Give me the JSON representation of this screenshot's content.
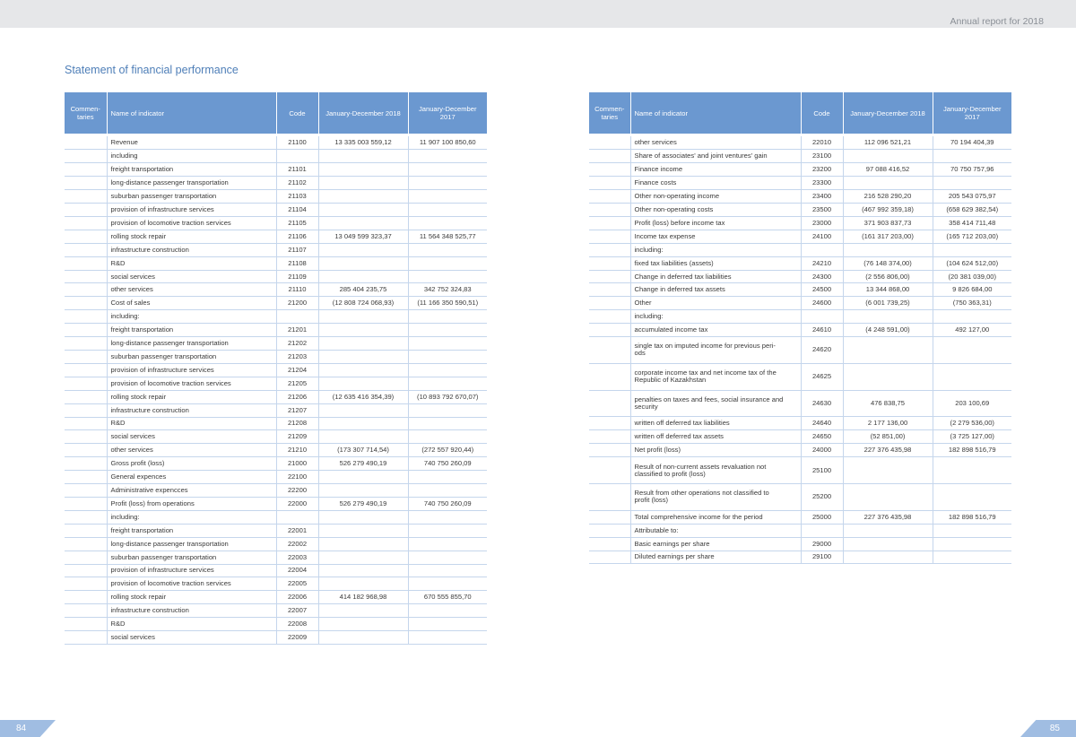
{
  "header": {
    "report_title": "Annual report for 2018"
  },
  "section_title": "Statement of financial performance",
  "table_headers": {
    "commentaries": "Commen-\ntaries",
    "name": "Name of indicator",
    "code": "Code",
    "period_2018": "January-December 2018",
    "period_2017": "January-December\n2017"
  },
  "left_rows": [
    {
      "name": "Revenue",
      "code": "21100",
      "v2018": "13 335 003 559,12",
      "v2017": "11 907 100 850,60"
    },
    {
      "name": "including",
      "code": "",
      "v2018": "",
      "v2017": ""
    },
    {
      "name": "freight transportation",
      "code": "21101",
      "v2018": "",
      "v2017": ""
    },
    {
      "name": "long-distance passenger transportation",
      "code": "21102",
      "v2018": "",
      "v2017": ""
    },
    {
      "name": "suburban passenger transportation",
      "code": "21103",
      "v2018": "",
      "v2017": ""
    },
    {
      "name": "provision of infrastructure services",
      "code": "21104",
      "v2018": "",
      "v2017": ""
    },
    {
      "name": "provision of locomotive traction services",
      "code": "21105",
      "v2018": "",
      "v2017": ""
    },
    {
      "name": "rolling stock repair",
      "code": "21106",
      "v2018": "13 049 599 323,37",
      "v2017": "11 564 348 525,77"
    },
    {
      "name": "infrastructure construction",
      "code": "21107",
      "v2018": "",
      "v2017": ""
    },
    {
      "name": "R&D",
      "code": "21108",
      "v2018": "",
      "v2017": ""
    },
    {
      "name": "social services",
      "code": "21109",
      "v2018": "",
      "v2017": ""
    },
    {
      "name": "other services",
      "code": "21110",
      "v2018": "285 404 235,75",
      "v2017": "342 752 324,83"
    },
    {
      "name": "Cost of sales",
      "code": "21200",
      "v2018": "(12 808 724 068,93)",
      "v2017": "(11 166 350 590,51)"
    },
    {
      "name": "including:",
      "code": "",
      "v2018": "",
      "v2017": ""
    },
    {
      "name": "freight transportation",
      "code": "21201",
      "v2018": "",
      "v2017": ""
    },
    {
      "name": "long-distance passenger transportation",
      "code": "21202",
      "v2018": "",
      "v2017": ""
    },
    {
      "name": "suburban passenger transportation",
      "code": "21203",
      "v2018": "",
      "v2017": ""
    },
    {
      "name": "provision of infrastructure services",
      "code": "21204",
      "v2018": "",
      "v2017": ""
    },
    {
      "name": "provision of locomotive traction services",
      "code": "21205",
      "v2018": "",
      "v2017": ""
    },
    {
      "name": "rolling stock repair",
      "code": "21206",
      "v2018": "(12 635 416 354,39)",
      "v2017": "(10 893 792 670,07)"
    },
    {
      "name": "infrastructure construction",
      "code": "21207",
      "v2018": "",
      "v2017": ""
    },
    {
      "name": "R&D",
      "code": "21208",
      "v2018": "",
      "v2017": ""
    },
    {
      "name": "social services",
      "code": "21209",
      "v2018": "",
      "v2017": ""
    },
    {
      "name": "other services",
      "code": "21210",
      "v2018": "(173 307 714,54)",
      "v2017": "(272 557 920,44)"
    },
    {
      "name": "Gross profit (loss)",
      "code": "21000",
      "v2018": "526 279 490,19",
      "v2017": "740 750 260,09"
    },
    {
      "name": "General expences",
      "code": "22100",
      "v2018": "",
      "v2017": ""
    },
    {
      "name": "Administrative expencces",
      "code": "22200",
      "v2018": "",
      "v2017": ""
    },
    {
      "name": "Profit (loss) from operations",
      "code": "22000",
      "v2018": "526 279 490,19",
      "v2017": "740 750 260,09"
    },
    {
      "name": "including:",
      "code": "",
      "v2018": "",
      "v2017": ""
    },
    {
      "name": "freight transportation",
      "code": "22001",
      "v2018": "",
      "v2017": ""
    },
    {
      "name": "long-distance passenger transportation",
      "code": "22002",
      "v2018": "",
      "v2017": ""
    },
    {
      "name": "suburban passenger transportation",
      "code": "22003",
      "v2018": "",
      "v2017": ""
    },
    {
      "name": "provision of infrastructure services",
      "code": "22004",
      "v2018": "",
      "v2017": ""
    },
    {
      "name": "provision of locomotive traction services",
      "code": "22005",
      "v2018": "",
      "v2017": ""
    },
    {
      "name": "rolling stock repair",
      "code": "22006",
      "v2018": "414 182 968,98",
      "v2017": "670 555 855,70"
    },
    {
      "name": "infrastructure construction",
      "code": "22007",
      "v2018": "",
      "v2017": ""
    },
    {
      "name": "R&D",
      "code": "22008",
      "v2018": "",
      "v2017": ""
    },
    {
      "name": "social services",
      "code": "22009",
      "v2018": "",
      "v2017": ""
    }
  ],
  "right_rows": [
    {
      "name": "other services",
      "code": "22010",
      "v2018": "112 096 521,21",
      "v2017": "70 194 404,39"
    },
    {
      "name": "Share of associates' and joint ventures' gain",
      "code": "23100",
      "v2018": "",
      "v2017": ""
    },
    {
      "name": "Finance income",
      "code": "23200",
      "v2018": "97 088 416,52",
      "v2017": "70 750 757,96"
    },
    {
      "name": "Finance costs",
      "code": "23300",
      "v2018": "",
      "v2017": ""
    },
    {
      "name": "Other non-operating income",
      "code": "23400",
      "v2018": "216 528 290,20",
      "v2017": "205 543 075,97"
    },
    {
      "name": "Other non-operating costs",
      "code": "23500",
      "v2018": "(467 992 359,18)",
      "v2017": "(658 629 382,54)"
    },
    {
      "name": "Profit (loss) before income tax",
      "code": "23000",
      "v2018": "371 903 837,73",
      "v2017": "358 414 711,48"
    },
    {
      "name": "Income tax expense",
      "code": "24100",
      "v2018": "(161 317 203,00)",
      "v2017": "(165 712 203,00)"
    },
    {
      "name": "including:",
      "code": "",
      "v2018": "",
      "v2017": ""
    },
    {
      "name": "fixed tax liabilities (assets)",
      "code": "24210",
      "v2018": "(76 148 374,00)",
      "v2017": "(104 624 512,00)"
    },
    {
      "name": "Change in deferred tax liabilities",
      "code": "24300",
      "v2018": "(2 556 806,00)",
      "v2017": "(20 381 039,00)"
    },
    {
      "name": "Change in deferred tax assets",
      "code": "24500",
      "v2018": "13 344 868,00",
      "v2017": "9 826 684,00"
    },
    {
      "name": "Other",
      "code": "24600",
      "v2018": "(6 001 739,25)",
      "v2017": "(750 363,31)"
    },
    {
      "name": "including:",
      "code": "",
      "v2018": "",
      "v2017": ""
    },
    {
      "name": "accumulated income tax",
      "code": "24610",
      "v2018": "(4 248 591,00)",
      "v2017": "492 127,00"
    },
    {
      "name": "single tax on imputed income for previous peri-\nods",
      "code": "24620",
      "v2018": "",
      "v2017": "",
      "tall": true
    },
    {
      "name": "corporate income tax and net income tax of the\nRepublic of Kazakhstan",
      "code": "24625",
      "v2018": "",
      "v2017": "",
      "tall": true
    },
    {
      "name": "penalties on taxes and fees, social insurance and\nsecurity",
      "code": "24630",
      "v2018": "476 838,75",
      "v2017": "203 100,69",
      "tall": true
    },
    {
      "name": "written off deferred tax liabilities",
      "code": "24640",
      "v2018": "2 177 136,00",
      "v2017": "(2 279 536,00)"
    },
    {
      "name": "written off deferred tax assets",
      "code": "24650",
      "v2018": "(52 851,00)",
      "v2017": "(3 725 127,00)"
    },
    {
      "name": "Net profit (loss)",
      "code": "24000",
      "v2018": "227 376 435,98",
      "v2017": "182 898 516,79"
    },
    {
      "name": "Result of non-current assets revaluation not\nclassified to profit (loss)",
      "code": "25100",
      "v2018": "",
      "v2017": "",
      "tall": true
    },
    {
      "name": "Result from other operations not classified to\nprofit (loss)",
      "code": "25200",
      "v2018": "",
      "v2017": "",
      "tall": true
    },
    {
      "name": "Total comprehensive income for the period",
      "code": "25000",
      "v2018": "227 376 435,98",
      "v2017": "182 898 516,79"
    },
    {
      "name": "Attributable to:",
      "code": "",
      "v2018": "",
      "v2017": ""
    },
    {
      "name": "Basic earnings per share",
      "code": "29000",
      "v2018": "",
      "v2017": ""
    },
    {
      "name": "Diluted earnings per share",
      "code": "29100",
      "v2018": "",
      "v2017": ""
    }
  ],
  "footer": {
    "page_left": "84",
    "page_right": "85"
  }
}
